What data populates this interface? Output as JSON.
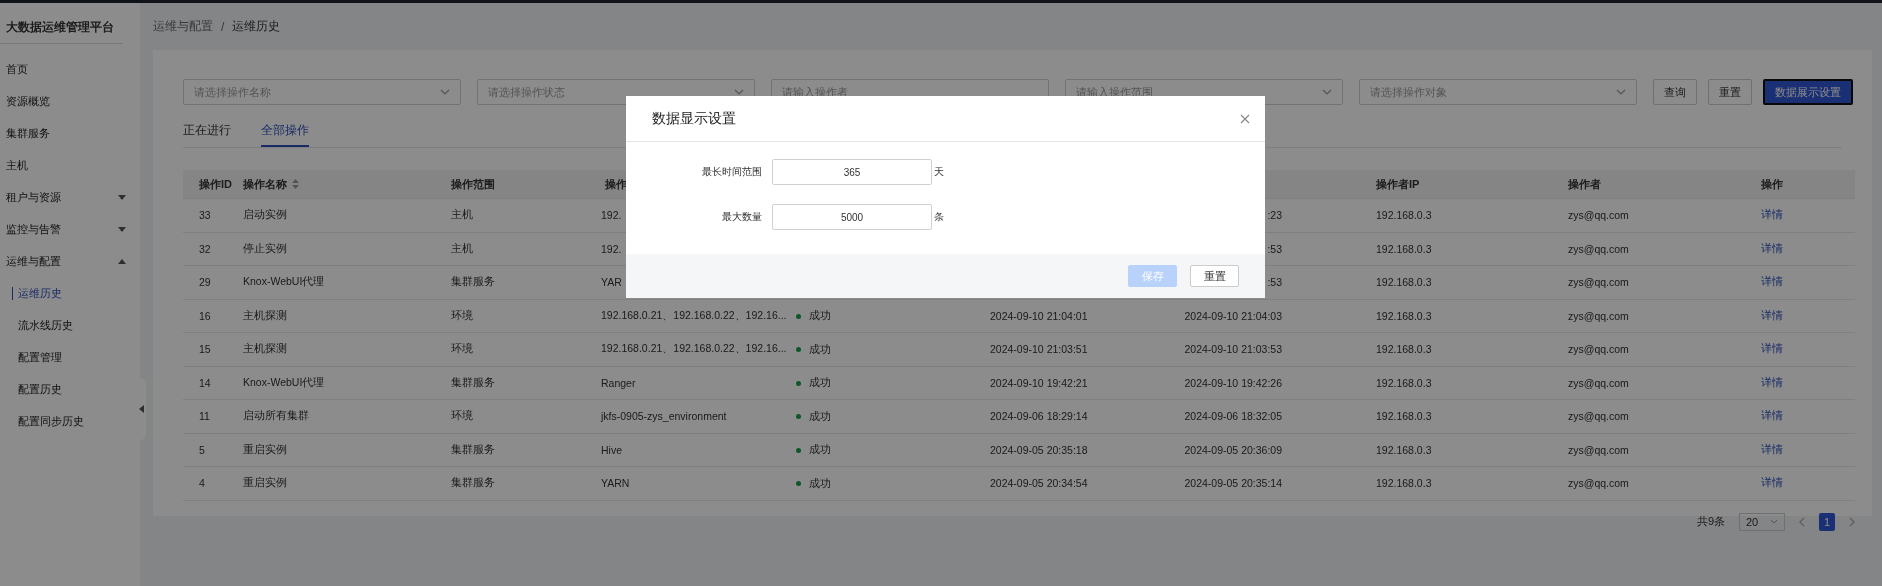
{
  "sidebar": {
    "title": "大数据运维管理平台",
    "items": [
      {
        "label": "首页",
        "selected": false
      },
      {
        "label": "资源概览",
        "selected": false
      },
      {
        "label": "集群服务",
        "selected": false
      },
      {
        "label": "主机",
        "selected": false
      },
      {
        "label": "租户与资源",
        "selected": false,
        "expanded": false
      },
      {
        "label": "监控与告警",
        "selected": false,
        "expanded": false
      },
      {
        "label": "运维与配置",
        "selected": false,
        "expanded": true,
        "children": [
          {
            "label": "运维历史",
            "selected": true
          },
          {
            "label": "流水线历史",
            "selected": false
          },
          {
            "label": "配置管理",
            "selected": false
          },
          {
            "label": "配置历史",
            "selected": false
          },
          {
            "label": "配置同步历史",
            "selected": false
          }
        ]
      }
    ]
  },
  "breadcrumb": [
    "运维与配置",
    "运维历史"
  ],
  "breadcrumb_separator": "/",
  "filters": [
    {
      "kind": "select",
      "placeholder": "请选择操作名称"
    },
    {
      "kind": "select",
      "placeholder": "请选择操作状态"
    },
    {
      "kind": "input",
      "placeholder": "请输入操作者"
    },
    {
      "kind": "select",
      "placeholder": "请输入操作范围"
    },
    {
      "kind": "select",
      "placeholder": "请选择操作对象"
    }
  ],
  "buttons": [
    {
      "label": "查询",
      "primary": false
    },
    {
      "label": "重置",
      "primary": false
    },
    {
      "label": "数据展示设置",
      "primary": true
    }
  ],
  "tabs": [
    {
      "label": "正在进行",
      "selected": false
    },
    {
      "label": "全部操作",
      "selected": true
    }
  ],
  "table": {
    "columns": [
      {
        "label": "操作ID",
        "sortable": false
      },
      {
        "label": "操作名称",
        "sortable": true
      },
      {
        "label": "操作范围",
        "sortable": false
      },
      {
        "label": "操作"
      },
      {},
      {},
      {},
      {
        "label": "操作者IP",
        "sortable": false
      },
      {
        "label": "操作者",
        "sortable": false
      },
      {
        "label": "操作",
        "sortable": false
      }
    ],
    "rows": [
      {
        "cells": [
          "33",
          "启动实例",
          "主机",
          "192.",
          null,
          null,
          ":23",
          "192.168.0.3",
          "zys@qq.com",
          "详情"
        ]
      },
      {
        "cells": [
          "32",
          "停止实例",
          "主机",
          "192.",
          null,
          null,
          ":53",
          "192.168.0.3",
          "zys@qq.com",
          "详情"
        ]
      },
      {
        "cells": [
          "29",
          "Knox-WebUI代理",
          "集群服务",
          "YAR",
          null,
          null,
          ":53",
          "192.168.0.3",
          "zys@qq.com",
          "详情"
        ]
      },
      {
        "cells": [
          "16",
          "主机探测",
          "环境",
          "192.168.0.21、192.168.0.22、192.16...",
          "成功",
          "2024-09-10 21:04:01",
          "2024-09-10 21:04:03",
          "192.168.0.3",
          "zys@qq.com",
          "详情"
        ]
      },
      {
        "cells": [
          "15",
          "主机探测",
          "环境",
          "192.168.0.21、192.168.0.22、192.16...",
          "成功",
          "2024-09-10 21:03:51",
          "2024-09-10 21:03:53",
          "192.168.0.3",
          "zys@qq.com",
          "详情"
        ]
      },
      {
        "cells": [
          "14",
          "Knox-WebUI代理",
          "集群服务",
          "Ranger",
          "成功",
          "2024-09-10 19:42:21",
          "2024-09-10 19:42:26",
          "192.168.0.3",
          "zys@qq.com",
          "详情"
        ]
      },
      {
        "cells": [
          "11",
          "启动所有集群",
          "环境",
          "jkfs-0905-zys_environment",
          "成功",
          "2024-09-06 18:29:14",
          "2024-09-06 18:32:05",
          "192.168.0.3",
          "zys@qq.com",
          "详情"
        ]
      },
      {
        "cells": [
          "5",
          "重启实例",
          "集群服务",
          "Hive",
          "成功",
          "2024-09-05 20:35:18",
          "2024-09-05 20:36:09",
          "192.168.0.3",
          "zys@qq.com",
          "详情"
        ]
      },
      {
        "cells": [
          "4",
          "重启实例",
          "集群服务",
          "YARN",
          "成功",
          "2024-09-05 20:34:54",
          "2024-09-05 20:35:14",
          "192.168.0.3",
          "zys@qq.com",
          "详情"
        ]
      }
    ]
  },
  "pagination": {
    "total": "共9条",
    "page_size": "20",
    "pages": [
      {
        "label": "1",
        "selected": true
      }
    ]
  },
  "dialog": {
    "title": "数据显示设置",
    "fields": [
      {
        "label": "最长时间范围",
        "value": "365",
        "unit": "天"
      },
      {
        "label": "最大数量",
        "value": "5000",
        "unit": "条"
      }
    ],
    "buttons": [
      {
        "label": "保存",
        "kind": "primary",
        "disabled": true
      },
      {
        "label": "重置",
        "kind": "default",
        "disabled": false
      }
    ]
  }
}
